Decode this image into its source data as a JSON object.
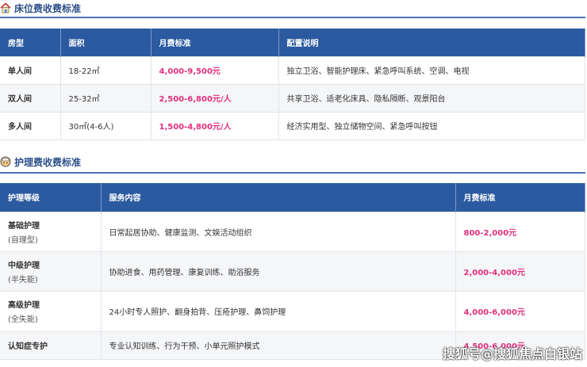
{
  "bed": {
    "title": "床位费收费标准",
    "headers": [
      "房型",
      "面积",
      "月费标准",
      "配置说明"
    ],
    "rows": [
      [
        "单人间",
        "18-22㎡",
        "4,000-9,500元",
        "独立卫浴、智能护理床、紧急呼叫系统、空调、电视"
      ],
      [
        "双人间",
        "25-32㎡",
        "2,500-6,800元/人",
        "共享卫浴、适老化床具、隐私隔断、观景阳台"
      ],
      [
        "多人间",
        "30㎡(4-6人)",
        "1,500-4,800元/人",
        "经济实用型、独立储物空间、紧急呼叫按钮"
      ]
    ]
  },
  "care": {
    "title": "护理费收费标准",
    "headers": [
      "护理等级",
      "服务内容",
      "月费标准"
    ],
    "rows": [
      {
        "level": "基础护理",
        "sub": "(自理型)",
        "content": "日常起居协助、健康监测、文娱活动组织",
        "price": "800-2,000元"
      },
      {
        "level": "中级护理",
        "sub": "(半失能)",
        "content": "协助进食、用药管理、康复训练、助浴服务",
        "price": "2,000-4,000元"
      },
      {
        "level": "高级护理",
        "sub": "(全失能)",
        "content": "24小时专人照护、翻身拍背、压疮护理、鼻饲护理",
        "price": "4,000-6,000元"
      },
      {
        "level": "认知症专护",
        "content": "专业认知训练、行为干预、小单元照护模式",
        "price": "4,500-6,000元"
      }
    ]
  },
  "watermark": "搜狐号@搜狐焦点白银站",
  "colors": {
    "header": "#2b5aa0",
    "price": "#e0307f"
  }
}
